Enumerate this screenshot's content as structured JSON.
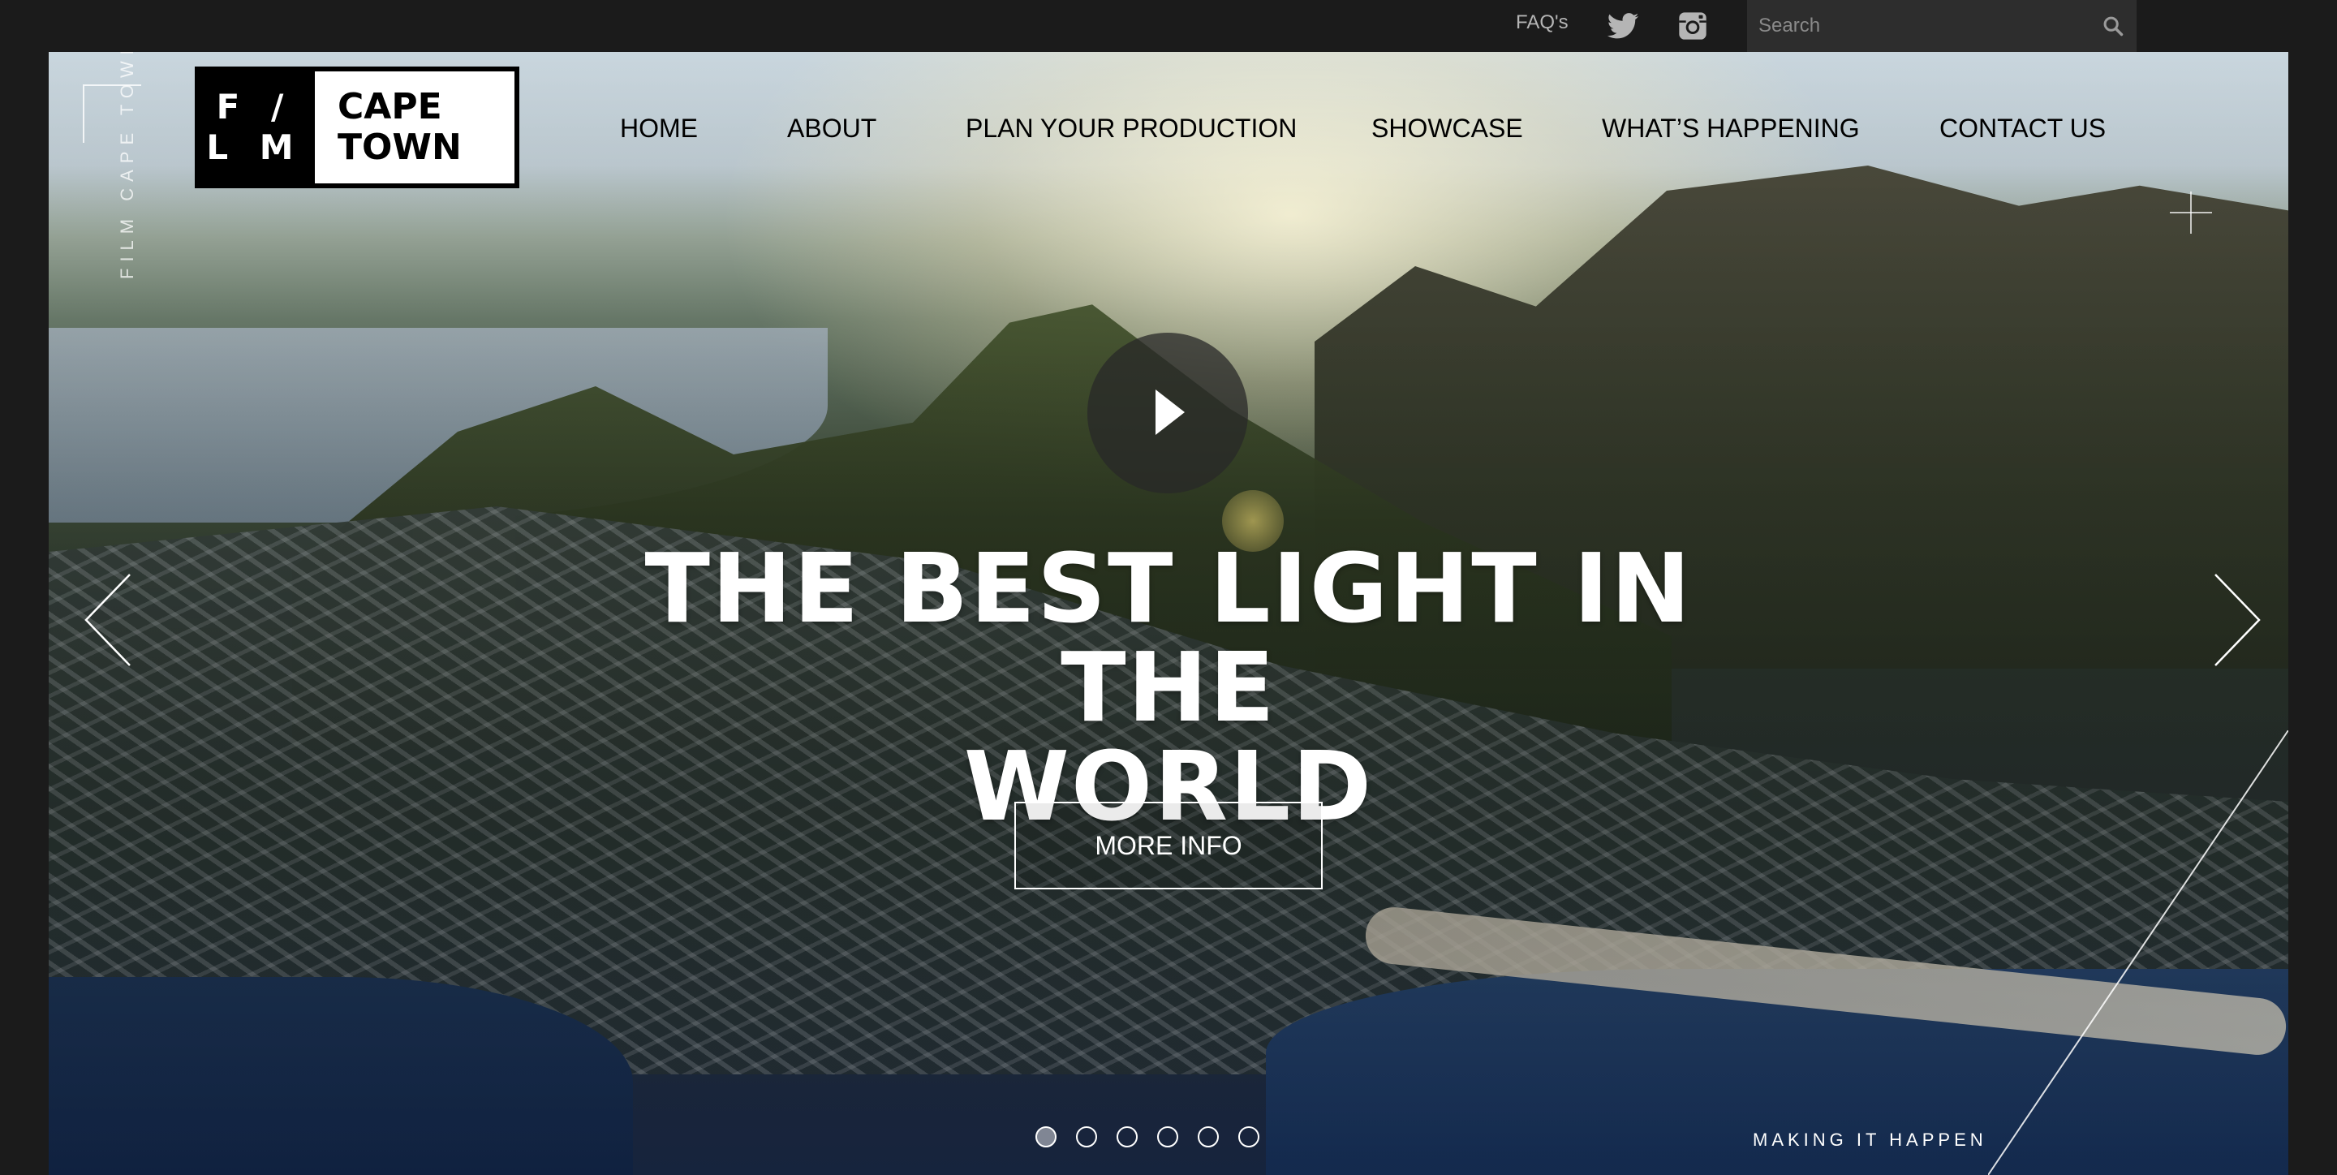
{
  "topbar": {
    "faq_label": "FAQ's",
    "twitter_icon": "twitter-icon",
    "instagram_icon": "instagram-icon",
    "search_placeholder": "Search",
    "search_icon": "search-icon"
  },
  "logo": {
    "mark_line1": "F /",
    "mark_line2": "L M",
    "name_line1": "CAPE",
    "name_line2": "TOWN"
  },
  "side_label": "FILM CAPE TOWN",
  "nav": {
    "items": [
      {
        "label": "HOME"
      },
      {
        "label": "ABOUT"
      },
      {
        "label": "PLAN YOUR PRODUCTION"
      },
      {
        "label": "SHOWCASE"
      },
      {
        "label": "WHAT’S HAPPENING"
      },
      {
        "label": "CONTACT US"
      }
    ]
  },
  "hero": {
    "headline_line1": "THE BEST LIGHT IN THE",
    "headline_line2": "WORLD",
    "cta_label": "MORE INFO",
    "play_icon": "play-icon",
    "prev_icon": "chevron-left-icon",
    "next_icon": "chevron-right-icon",
    "tagline": "MAKING IT HAPPEN",
    "slide_count": 6,
    "active_slide": 1
  },
  "colors": {
    "topbar_bg": "#1b1b1b",
    "search_bg": "#2d2d2d",
    "text_light": "#ffffff",
    "nav_text": "#000000"
  }
}
